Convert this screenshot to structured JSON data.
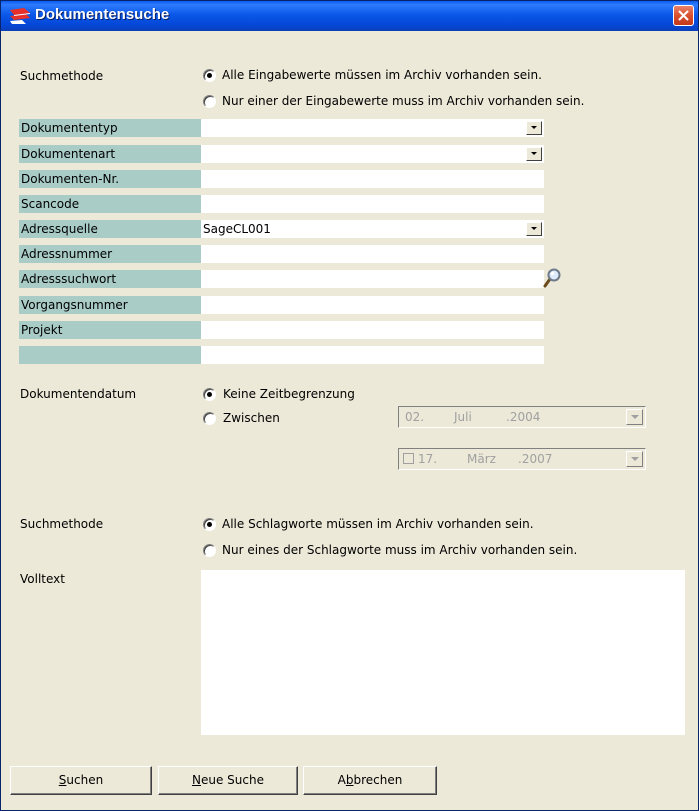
{
  "window": {
    "title": "Dokumentensuche"
  },
  "search_method": {
    "label": "Suchmethode",
    "options": [
      "Alle Eingabewerte müssen im Archiv vorhanden sein.",
      "Nur einer der Eingabewerte muss im Archiv vorhanden sein."
    ],
    "selected_index": 0
  },
  "fields": [
    {
      "label": "Dokumententyp",
      "value": "",
      "type": "combo"
    },
    {
      "label": "Dokumentenart",
      "value": "",
      "type": "combo"
    },
    {
      "label": "Dokumenten-Nr.",
      "value": "",
      "type": "text"
    },
    {
      "label": "Scancode",
      "value": "",
      "type": "text"
    },
    {
      "label": "Adressquelle",
      "value": "SageCL001",
      "type": "combo"
    },
    {
      "label": "Adressnummer",
      "value": "",
      "type": "text"
    },
    {
      "label": "Adresssuchwort",
      "value": "",
      "type": "text-search"
    },
    {
      "label": "Vorgangsnummer",
      "value": "",
      "type": "text"
    },
    {
      "label": "Projekt",
      "value": "",
      "type": "text"
    },
    {
      "label": "",
      "value": "",
      "type": "text"
    }
  ],
  "document_date": {
    "label": "Dokumentendatum",
    "options": [
      "Keine Zeitbegrenzung",
      "Zwischen"
    ],
    "selected_index": 0,
    "from": {
      "day": "02.",
      "month": "Juli",
      "year": ".2004"
    },
    "to": {
      "day": "17.",
      "month": "März",
      "year": ".2007"
    }
  },
  "keyword_method": {
    "label": "Suchmethode",
    "options": [
      "Alle Schlagworte müssen im Archiv vorhanden sein.",
      "Nur eines der Schlagworte muss im Archiv vorhanden sein."
    ],
    "selected_index": 0
  },
  "fulltext": {
    "label": "Volltext",
    "value": ""
  },
  "buttons": {
    "search": {
      "accel": "S",
      "rest": "uchen"
    },
    "new_search": {
      "accel": "N",
      "rest": "eue Suche"
    },
    "cancel": {
      "pre": "A",
      "accel": "b",
      "rest": "brechen"
    }
  },
  "colors": {
    "label_bg": "#A9CCC6",
    "window_bg": "#ECE9D8",
    "titlebar": "#0B58E8",
    "close": "#D9502E"
  }
}
